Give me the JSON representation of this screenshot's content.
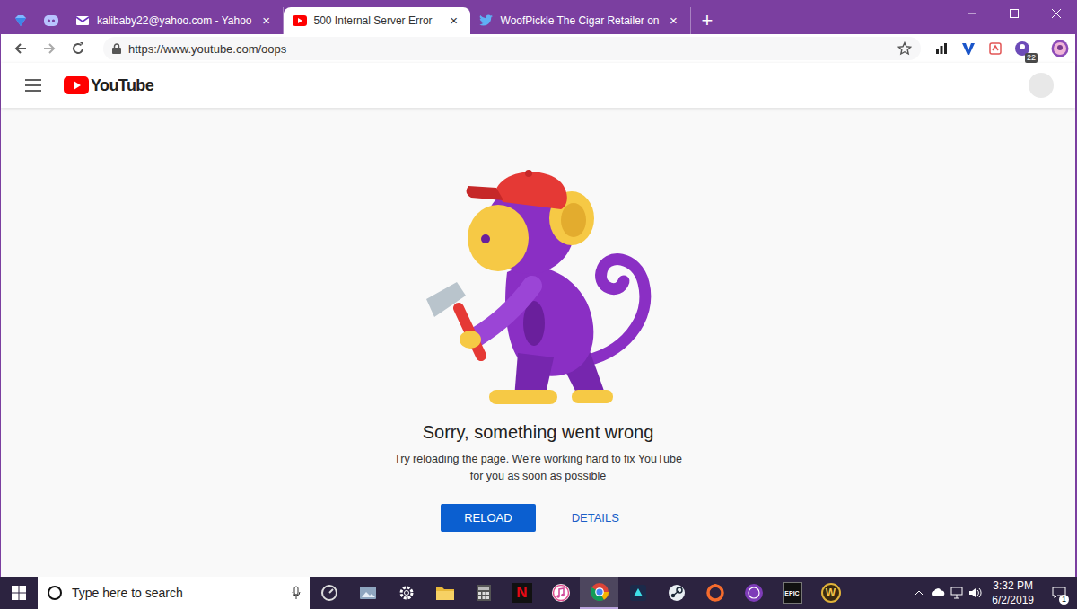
{
  "browser": {
    "tabs": [
      {
        "label": "kalibaby22@yahoo.com - Yahoo",
        "close": "×",
        "selected": false,
        "kind": "yahoo"
      },
      {
        "label": "500 Internal Server Error",
        "close": "×",
        "selected": true,
        "kind": "youtube"
      },
      {
        "label": "WoofPickle The Cigar Retailer on",
        "close": "×",
        "selected": false,
        "kind": "twitter"
      }
    ],
    "new_tab": "+",
    "address": "https://www.youtube.com/oops",
    "extension_badge": "22"
  },
  "youtube": {
    "logo": "YouTube"
  },
  "error": {
    "title": "Sorry, something went wrong",
    "message_lines": [
      "Try reloading the page. We're working hard to fix YouTube",
      "for you as soon as possible"
    ],
    "buttons": [
      {
        "label": "RELOAD",
        "kind": "primary"
      },
      {
        "label": "DETAILS",
        "kind": "text"
      }
    ]
  },
  "taskbar": {
    "search_placeholder": "Type here to search",
    "apps": [
      {
        "kind": "gauge",
        "label": "",
        "selected": false
      },
      {
        "kind": "photos",
        "label": "",
        "selected": false
      },
      {
        "kind": "settings",
        "label": "",
        "selected": false
      },
      {
        "kind": "explorer",
        "label": "",
        "selected": false
      },
      {
        "kind": "calculator",
        "label": "",
        "selected": false
      },
      {
        "kind": "netflix",
        "label": "N",
        "selected": false
      },
      {
        "kind": "itunes",
        "label": "",
        "selected": false
      },
      {
        "kind": "chrome",
        "label": "",
        "selected": true
      },
      {
        "kind": "launcher",
        "label": "",
        "selected": false
      },
      {
        "kind": "steam",
        "label": "",
        "selected": false
      },
      {
        "kind": "origin",
        "label": "",
        "selected": false
      },
      {
        "kind": "gog",
        "label": "",
        "selected": false
      },
      {
        "kind": "epic",
        "label": "EPIC",
        "selected": false
      },
      {
        "kind": "wow",
        "label": "W",
        "selected": false
      }
    ],
    "clock": {
      "time": "3:32 PM",
      "date": "6/2/2019"
    },
    "notifications": "1"
  }
}
